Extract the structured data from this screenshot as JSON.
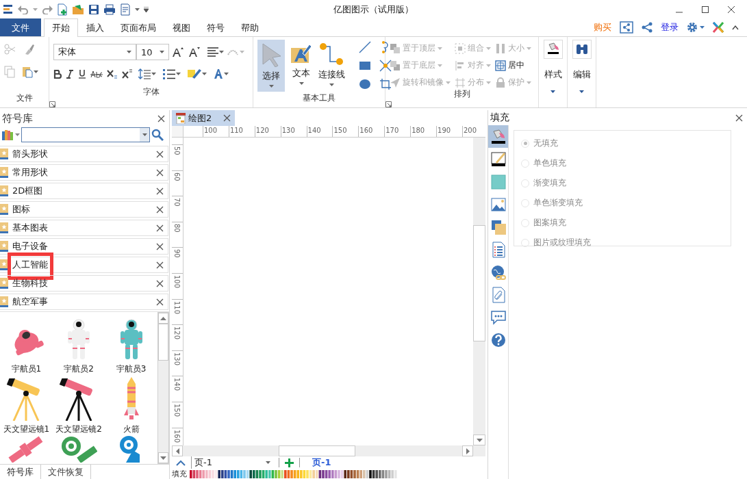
{
  "window": {
    "title": "亿图图示（试用版）"
  },
  "ribbon_tabs": [
    {
      "label": "文件",
      "kind": "file",
      "selected": false
    },
    {
      "label": "开始",
      "kind": "tab",
      "selected": true
    },
    {
      "label": "插入",
      "kind": "tab",
      "selected": false
    },
    {
      "label": "页面布局",
      "kind": "tab",
      "selected": false
    },
    {
      "label": "视图",
      "kind": "tab",
      "selected": false
    },
    {
      "label": "符号",
      "kind": "tab",
      "selected": false
    },
    {
      "label": "帮助",
      "kind": "tab",
      "selected": false
    }
  ],
  "account": {
    "buy": "购买",
    "login": "登录"
  },
  "ribbon": {
    "file_group": {
      "label": "文件"
    },
    "font_group": {
      "label": "字体",
      "font": "宋体",
      "size": "10"
    },
    "basic_tools": {
      "label": "基本工具",
      "buttons": [
        {
          "label": "选择",
          "kind": "select",
          "selected": true
        },
        {
          "label": "文本",
          "kind": "text",
          "selected": false
        },
        {
          "label": "连接线",
          "kind": "connector",
          "selected": false
        }
      ]
    },
    "arrange": {
      "label": "排列",
      "items": [
        {
          "label": "置于顶层",
          "kind": "front",
          "disabled": true
        },
        {
          "label": "组合",
          "kind": "group",
          "disabled": true
        },
        {
          "label": "大小",
          "kind": "size",
          "disabled": true
        },
        {
          "label": "置于底层",
          "kind": "back",
          "disabled": true
        },
        {
          "label": "对齐",
          "kind": "align",
          "disabled": true
        },
        {
          "label": "居中",
          "kind": "center",
          "disabled": false
        },
        {
          "label": "旋转和镜像",
          "kind": "rotate",
          "disabled": true
        },
        {
          "label": "分布",
          "kind": "distribute",
          "disabled": true
        },
        {
          "label": "保护",
          "kind": "lock",
          "disabled": true
        }
      ]
    },
    "style_group": {
      "label": "样式"
    },
    "edit_group": {
      "label": "编辑"
    }
  },
  "symbol_library": {
    "title": "符号库",
    "libraries": [
      {
        "label": "箭头形状",
        "highlighted": false
      },
      {
        "label": "常用形状",
        "highlighted": false
      },
      {
        "label": "2D框图",
        "highlighted": false
      },
      {
        "label": "图标",
        "highlighted": false
      },
      {
        "label": "基本图表",
        "highlighted": false
      },
      {
        "label": "电子设备",
        "highlighted": false
      },
      {
        "label": "人工智能",
        "highlighted": true
      },
      {
        "label": "生物科技",
        "highlighted": false
      },
      {
        "label": "航空军事",
        "highlighted": false
      }
    ],
    "symbols": [
      {
        "label": "宇航员1",
        "kind": "astronaut-floating",
        "color": "#ee6a82"
      },
      {
        "label": "宇航员2",
        "kind": "astronaut",
        "color": "#f0f0f0"
      },
      {
        "label": "宇航员3",
        "kind": "astronaut",
        "color": "#5bbfc2"
      },
      {
        "label": "天文望远镜1",
        "kind": "telescope",
        "color": "#f8c555"
      },
      {
        "label": "天文望远镜2",
        "kind": "telescope",
        "color": "#ee6a82"
      },
      {
        "label": "火箭",
        "kind": "rocket",
        "color": "#f8c555"
      },
      {
        "kind": "satellite",
        "color": "#ee6a82"
      },
      {
        "kind": "satellite-dish",
        "color": "#3ea055"
      },
      {
        "kind": "radar",
        "color": "#1a8ad0"
      }
    ],
    "bottom_tabs": [
      {
        "label": "符号库",
        "selected": true
      },
      {
        "label": "文件恢复",
        "selected": false
      }
    ]
  },
  "document_tab": {
    "label": "绘图2"
  },
  "rulers": {
    "horizontal": [
      "100",
      "110",
      "120",
      "130",
      "140",
      "150",
      "160",
      "170",
      "180",
      "190",
      "200"
    ],
    "vertical": [
      "50",
      "60",
      "70",
      "80",
      "90",
      "100",
      "110",
      "120",
      "130",
      "140",
      "150",
      "160"
    ]
  },
  "page_bar": {
    "page_select": "页-1",
    "pages": [
      {
        "label": "页-1",
        "selected": true
      }
    ]
  },
  "palette": {
    "label": "填充"
  },
  "fill_panel": {
    "title": "填充",
    "tools": [
      {
        "kind": "fill",
        "selected": true
      },
      {
        "kind": "line",
        "selected": false
      },
      {
        "kind": "shadow",
        "selected": false
      },
      {
        "kind": "image",
        "selected": false
      },
      {
        "kind": "layers",
        "selected": false
      },
      {
        "kind": "list",
        "selected": false
      },
      {
        "kind": "hyperlink",
        "selected": false
      },
      {
        "kind": "attachment",
        "selected": false
      },
      {
        "kind": "comment",
        "selected": false
      },
      {
        "kind": "help",
        "selected": false
      }
    ],
    "options": [
      {
        "label": "无填充",
        "selected": true
      },
      {
        "label": "单色填充",
        "selected": false
      },
      {
        "label": "渐变填充",
        "selected": false
      },
      {
        "label": "单色渐变填充",
        "selected": false
      },
      {
        "label": "图案填充",
        "selected": false
      },
      {
        "label": "图片或纹理填充",
        "selected": false
      }
    ]
  }
}
